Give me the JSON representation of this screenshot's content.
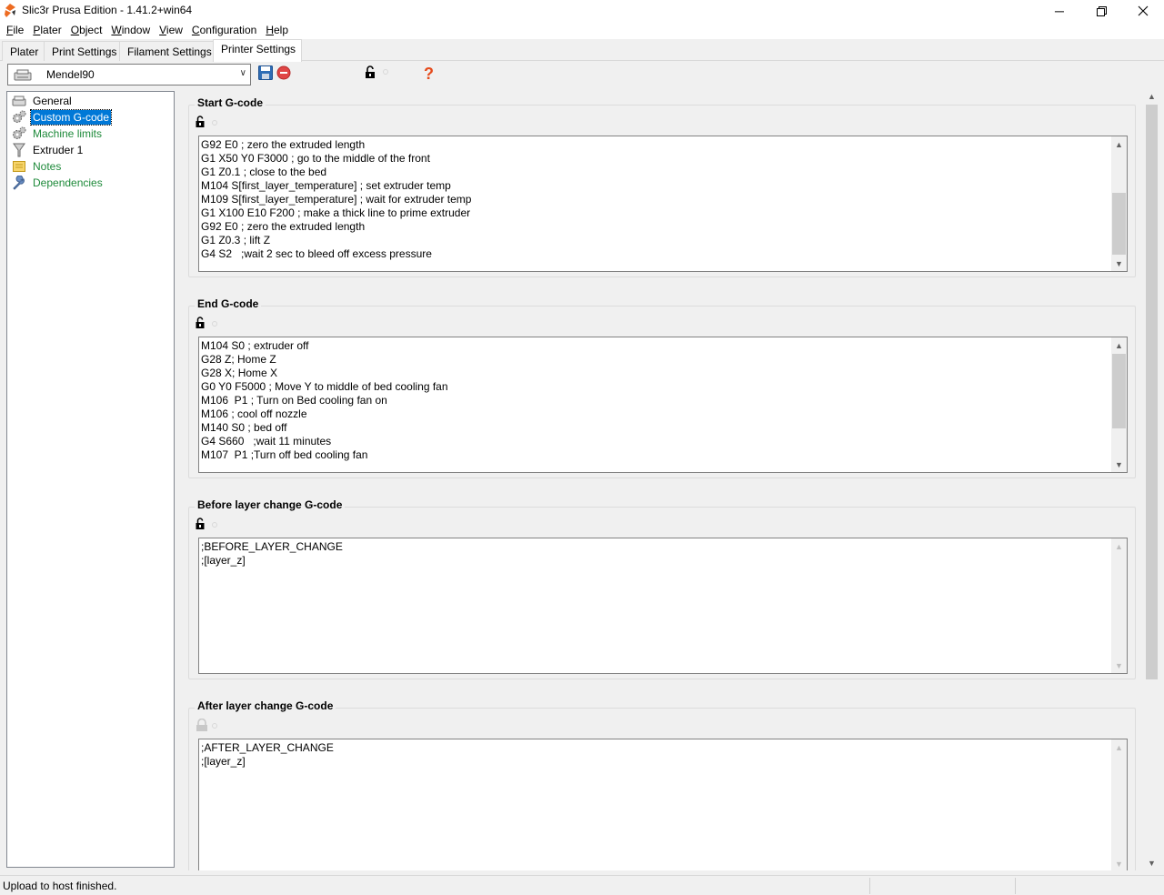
{
  "window": {
    "title": "Slic3r Prusa Edition - 1.41.2+win64"
  },
  "menu": [
    {
      "key": "F",
      "rest": "ile"
    },
    {
      "key": "P",
      "rest": "later"
    },
    {
      "key": "O",
      "rest": "bject"
    },
    {
      "key": "W",
      "rest": "indow"
    },
    {
      "key": "V",
      "rest": "iew"
    },
    {
      "key": "C",
      "rest": "onfiguration"
    },
    {
      "key": "H",
      "rest": "elp"
    }
  ],
  "tabs": [
    "Plater",
    "Print Settings",
    "Filament Settings",
    "Printer Settings"
  ],
  "active_tab": "Printer Settings",
  "preset": {
    "value": "Mendel90"
  },
  "tree": [
    {
      "label": "General",
      "icon": "printer-icon",
      "color": "normal"
    },
    {
      "label": "Custom G-code",
      "icon": "gears-icon",
      "color": "selected"
    },
    {
      "label": "Machine limits",
      "icon": "gears-icon",
      "color": "green"
    },
    {
      "label": "Extruder 1",
      "icon": "funnel-icon",
      "color": "normal"
    },
    {
      "label": "Notes",
      "icon": "note-icon",
      "color": "green"
    },
    {
      "label": "Dependencies",
      "icon": "wrench-icon",
      "color": "green"
    }
  ],
  "sections": [
    {
      "title": "Start G-code",
      "lines": [
        "G92 E0 ; zero the extruded length",
        "G1 X50 Y0 F3000 ; go to the middle of the front",
        "G1 Z0.1 ; close to the bed",
        "M104 S[first_layer_temperature] ; set extruder temp",
        "M109 S[first_layer_temperature] ; wait for extruder temp",
        "G1 X100 E10 F200 ; make a thick line to prime extruder",
        "G92 E0 ; zero the extruded length",
        "G1 Z0.3 ; lift Z",
        "G4 S2   ;wait 2 sec to bleed off excess pressure"
      ]
    },
    {
      "title": "End G-code",
      "lines": [
        "M104 S0 ; extruder off",
        "G28 Z; Home Z",
        "G28 X; Home X",
        "G0 Y0 F5000 ; Move Y to middle of bed cooling fan",
        "M106  P1 ; Turn on Bed cooling fan on",
        "M106 ; cool off nozzle",
        "M140 S0 ; bed off",
        "G4 S660   ;wait 11 minutes",
        "M107  P1 ;Turn off bed cooling fan"
      ]
    },
    {
      "title": "Before layer change G-code",
      "lines": [
        ";BEFORE_LAYER_CHANGE",
        ";[layer_z]"
      ]
    },
    {
      "title": "After layer change G-code",
      "lines": [
        ";AFTER_LAYER_CHANGE",
        ";[layer_z]"
      ]
    }
  ],
  "status": {
    "text": "Upload to host finished."
  }
}
